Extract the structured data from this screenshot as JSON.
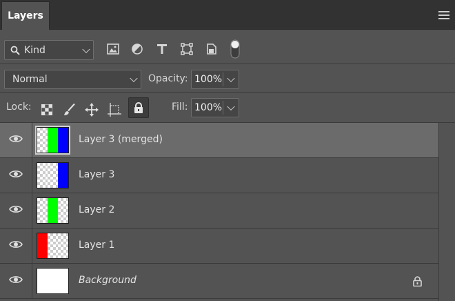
{
  "panel": {
    "tab_title": "Layers"
  },
  "filter": {
    "kind_label": "Kind",
    "icons": [
      "image-filter-icon",
      "adjustment-filter-icon",
      "type-filter-icon",
      "shape-filter-icon",
      "smart-object-filter-icon",
      "filter-toggle-icon"
    ]
  },
  "blend": {
    "mode": "Normal",
    "opacity_label": "Opacity:",
    "opacity_value": "100%"
  },
  "lock": {
    "label": "Lock:",
    "fill_label": "Fill:",
    "fill_value": "100%"
  },
  "layers": [
    {
      "name": "Layer 3 (merged)",
      "selected": true,
      "thumb": [
        "checker",
        "#00ff00",
        "#0000ff"
      ],
      "italic": false
    },
    {
      "name": "Layer 3",
      "selected": false,
      "thumb": [
        "checker",
        "checker",
        "#0000ff"
      ],
      "italic": false
    },
    {
      "name": "Layer 2",
      "selected": false,
      "thumb": [
        "checker",
        "#00ff00",
        "checker"
      ],
      "italic": false
    },
    {
      "name": "Layer 1",
      "selected": false,
      "thumb": [
        "#ff0000",
        "checker",
        "checker"
      ],
      "italic": false
    },
    {
      "name": "Background",
      "selected": false,
      "thumb": [
        "#ffffff",
        "#ffffff",
        "#ffffff"
      ],
      "italic": true,
      "locked": true
    }
  ],
  "colors": {
    "panel_bg": "#535353",
    "selected_row": "#6b6b6b",
    "red": "#ff0000",
    "green": "#00ff00",
    "blue": "#0000ff"
  }
}
